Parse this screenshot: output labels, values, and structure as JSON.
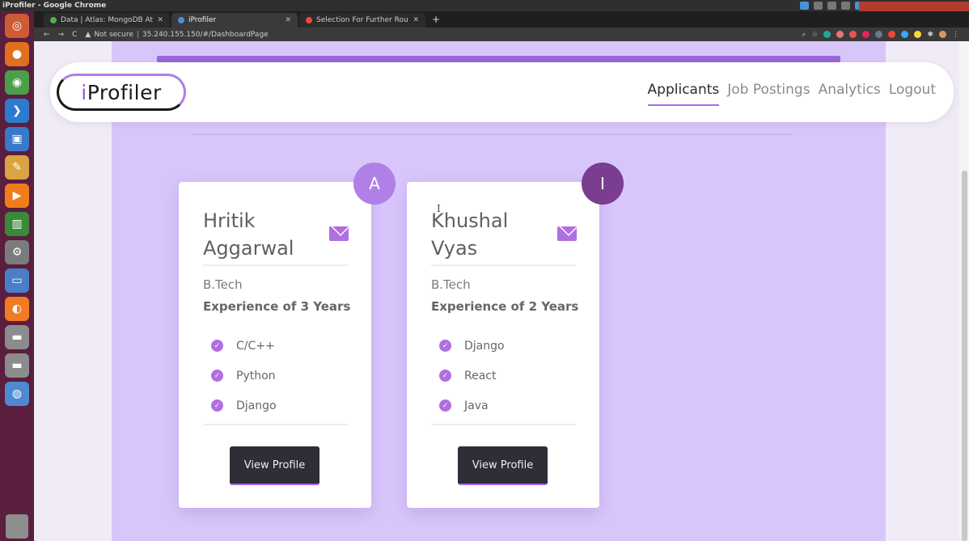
{
  "os": {
    "window_title": "iProfiler - Google Chrome"
  },
  "launcher": {
    "apps": [
      {
        "icon": "ubuntu-dash-icon",
        "color": "#cf5b35",
        "glyph": "◎"
      },
      {
        "icon": "firefox-icon",
        "color": "#e0701e",
        "glyph": "●"
      },
      {
        "icon": "chrome-icon",
        "color": "#4aa04a",
        "glyph": "◉"
      },
      {
        "icon": "vscode-icon",
        "color": "#2d7bd1",
        "glyph": "❯"
      },
      {
        "icon": "files-icon",
        "color": "#3a78c9",
        "glyph": "▣"
      },
      {
        "icon": "text-editor-icon",
        "color": "#d9a441",
        "glyph": "✎"
      },
      {
        "icon": "media-player-icon",
        "color": "#ef7d1c",
        "glyph": "▶"
      },
      {
        "icon": "charts-icon",
        "color": "#3b8a3b",
        "glyph": "▥"
      },
      {
        "icon": "settings-icon",
        "color": "#7b7b7b",
        "glyph": "⚙"
      },
      {
        "icon": "presentation-icon",
        "color": "#4a7ec9",
        "glyph": "▭"
      },
      {
        "icon": "safari-icon",
        "color": "#f07b22",
        "glyph": "◐"
      },
      {
        "icon": "disk-icon",
        "color": "#8c8c8c",
        "glyph": "▬"
      },
      {
        "icon": "disk-icon",
        "color": "#8c8c8c",
        "glyph": "▬"
      },
      {
        "icon": "network-icon",
        "color": "#4e8ad2",
        "glyph": "◍"
      }
    ]
  },
  "browser": {
    "tabs": [
      {
        "label": "Data | Atlas: MongoDB At",
        "favicon_color": "#4caf50",
        "active": false
      },
      {
        "label": "iProfiler",
        "favicon_color": "#4a90d9",
        "active": true
      },
      {
        "label": "Selection For Further Rou",
        "favicon_color": "#e94b3c",
        "active": false
      }
    ],
    "security": "Not secure",
    "url": "35.240.155.150/#/DashboardPage"
  },
  "navbar": {
    "logo_prefix": "i",
    "logo_rest": "Profiler",
    "links": [
      "Applicants",
      "Job Postings",
      "Analytics",
      "Logout"
    ],
    "active_link": "Applicants"
  },
  "cards": [
    {
      "initial": "A",
      "avatar_color": "#b07fe8",
      "first_name": "Hritik",
      "last_name": "Aggarwal",
      "degree": "B.Tech",
      "experience": "Experience of 3 Years",
      "skills": [
        "C/C++",
        "Python",
        "Django"
      ],
      "button": "View Profile"
    },
    {
      "initial": "I",
      "avatar_color": "#7a3d8f",
      "first_name": "Khushal",
      "last_name": "Vyas",
      "degree": "B.Tech",
      "experience": "Experience of 2 Years",
      "skills": [
        "Django",
        "React",
        "Java"
      ],
      "button": "View Profile"
    }
  ]
}
